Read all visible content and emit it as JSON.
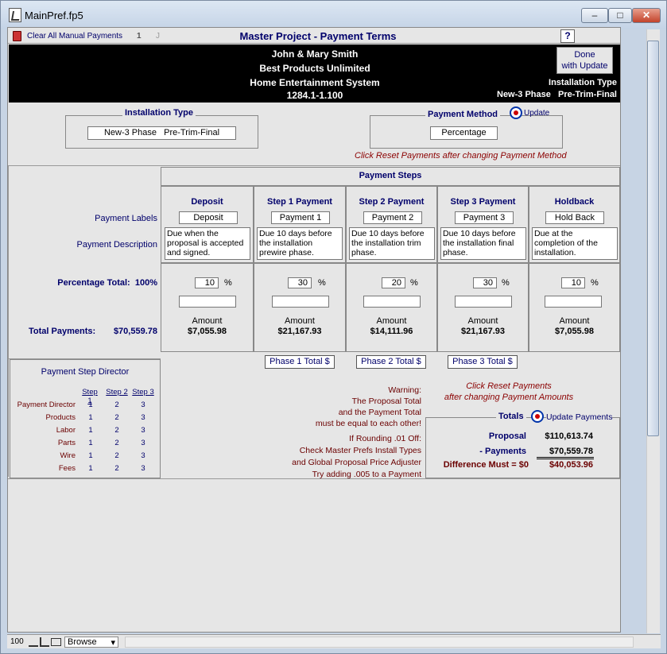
{
  "window": {
    "title": "MainPref.fp5"
  },
  "toolbar": {
    "clear_label": "Clear All Manual Payments",
    "jump1": "1",
    "jump2": "J",
    "help": "?"
  },
  "page_title": "Master Project - Payment Terms",
  "header": {
    "client": "John & Mary Smith",
    "company": "Best Products Unlimited",
    "system": "Home Entertainment System",
    "project_no": "1284.1-1.100",
    "done_line1": "Done",
    "done_line2": "with Update",
    "install_type_label": "Installation Type",
    "install_type_value": "New-3 Phase   Pre-Trim-Final"
  },
  "installation_type": {
    "title": "Installation Type",
    "value": "New-3 Phase   Pre-Trim-Final"
  },
  "payment_method": {
    "title": "Payment Method",
    "update_label": "Update",
    "value": "Percentage",
    "note": "Click Reset Payments after changing Payment Method"
  },
  "payment_steps": {
    "title": "Payment Steps",
    "labels_caption": "Payment Labels",
    "desc_caption": "Payment Description",
    "pct_total_label": "Percentage Total:",
    "pct_total_value": "100%",
    "total_payments_label": "Total Payments:",
    "total_payments_value": "$70,559.78",
    "amount_label": "Amount",
    "pct_sign": "%",
    "columns": [
      {
        "header": "Deposit",
        "label": "Deposit",
        "description": "Due when the proposal is accepted and signed.",
        "pct": "10",
        "amount": "$7,055.98"
      },
      {
        "header": "Step 1 Payment",
        "label": "Payment 1",
        "description": "Due 10 days before the installation prewire phase.",
        "pct": "30",
        "amount": "$21,167.93"
      },
      {
        "header": "Step 2 Payment",
        "label": "Payment 2",
        "description": "Due 10 days before the installation trim phase.",
        "pct": "20",
        "amount": "$14,111.96"
      },
      {
        "header": "Step 3 Payment",
        "label": "Payment 3",
        "description": "Due 10 days before the installation final phase.",
        "pct": "30",
        "amount": "$21,167.93"
      },
      {
        "header": "Holdback",
        "label": "Hold Back",
        "description": "Due at the completion of the installation.",
        "pct": "10",
        "amount": "$7,055.98"
      }
    ]
  },
  "phase_buttons": [
    "Phase 1 Total $",
    "Phase 2 Total $",
    "Phase 3 Total $"
  ],
  "director": {
    "title": "Payment Step Director",
    "col_headers": [
      "Step 1",
      "Step 2",
      "Step 3"
    ],
    "rows": [
      {
        "label": "Payment Director",
        "v": [
          "1",
          "2",
          "3"
        ]
      },
      {
        "label": "Products",
        "v": [
          "1",
          "2",
          "3"
        ]
      },
      {
        "label": "Labor",
        "v": [
          "1",
          "2",
          "3"
        ]
      },
      {
        "label": "Parts",
        "v": [
          "1",
          "2",
          "3"
        ]
      },
      {
        "label": "Wire",
        "v": [
          "1",
          "2",
          "3"
        ]
      },
      {
        "label": "Fees",
        "v": [
          "1",
          "2",
          "3"
        ]
      }
    ]
  },
  "warning": {
    "lines": [
      "Warning:",
      "The Proposal Total",
      "and the Payment Total",
      "must be equal to each other!"
    ],
    "rounding": [
      "If Rounding .01 Off:",
      "Check Master Prefs Install Types",
      "and Global Proposal Price Adjuster",
      "Try adding .005 to a Payment"
    ]
  },
  "reset_note": [
    "Click Reset Payments",
    "after changing Payment Amounts"
  ],
  "totals": {
    "title": "Totals",
    "update_label": "Update Payments",
    "proposal_label": "Proposal",
    "proposal_value": "$110,613.74",
    "payments_label": "- Payments",
    "payments_value": "$70,559.78",
    "difference_label": "Difference Must = $0",
    "difference_value": "$40,053.96"
  },
  "statusbar": {
    "zoom": "100",
    "mode": "Browse"
  }
}
